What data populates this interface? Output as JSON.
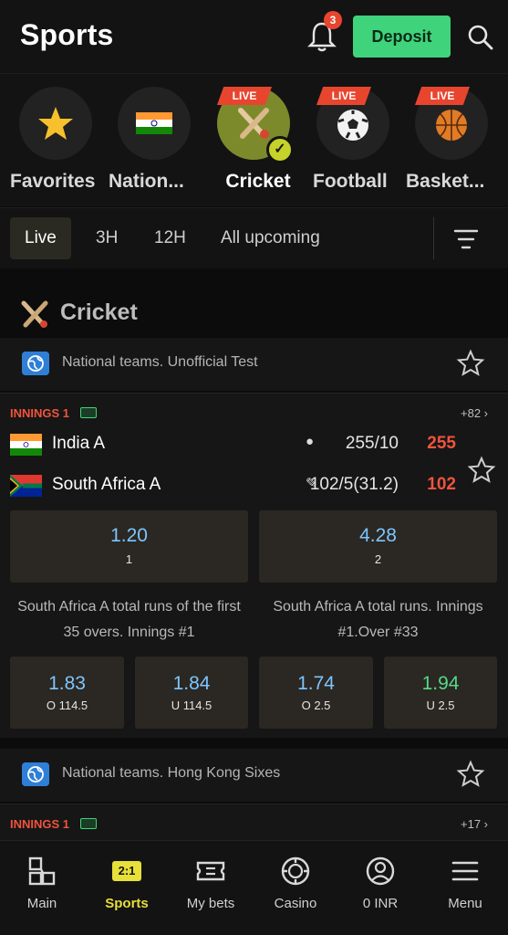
{
  "header": {
    "title": "Sports",
    "notifications_count": "3",
    "deposit_label": "Deposit"
  },
  "sports": [
    {
      "label": "Favorites",
      "icon": "star-icon",
      "live": false,
      "active": false
    },
    {
      "label": "Nation...",
      "icon": "india-flag-icon",
      "live": false,
      "active": false
    },
    {
      "label": "Cricket",
      "icon": "cricket-icon",
      "live": true,
      "active": true
    },
    {
      "label": "Football",
      "icon": "football-icon",
      "live": true,
      "active": false
    },
    {
      "label": "Basket...",
      "icon": "basketball-icon",
      "live": true,
      "active": false
    }
  ],
  "live_tag": "LIVE",
  "time_filters": [
    "Live",
    "3H",
    "12H",
    "All upcoming"
  ],
  "section": {
    "title": "Cricket"
  },
  "match1": {
    "league": "National teams. Unofficial Test",
    "innings": "INNINGS 1",
    "more": "+82 ›",
    "team1": {
      "name": "India A",
      "marker": "●",
      "score": "255/10",
      "total": "255"
    },
    "team2": {
      "name": "South Africa A",
      "marker": "✎",
      "score": "102/5(31.2)",
      "total": "102"
    },
    "main_odds": [
      {
        "value": "1.20",
        "label": "1"
      },
      {
        "value": "4.28",
        "label": "2"
      }
    ],
    "market1": {
      "title": "South Africa A total runs of the first 35 overs. Innings #1"
    },
    "market2": {
      "title": "South Africa A total runs. Innings #1.Over #33"
    },
    "market_odds": [
      {
        "value": "1.83",
        "label": "O 114.5"
      },
      {
        "value": "1.84",
        "label": "U 114.5"
      },
      {
        "value": "1.74",
        "label": "O 2.5"
      },
      {
        "value": "1.94",
        "label": "U 2.5"
      }
    ]
  },
  "match2": {
    "league": "National teams. Hong Kong Sixes",
    "innings": "INNINGS 1",
    "more": "+17 ›"
  },
  "nav": [
    {
      "label": "Main",
      "icon": "main-icon"
    },
    {
      "label": "Sports",
      "icon": "sports-ratio-icon",
      "badge": "2:1"
    },
    {
      "label": "My bets",
      "icon": "ticket-icon"
    },
    {
      "label": "Casino",
      "icon": "casino-chip-icon"
    },
    {
      "label": "0 INR",
      "icon": "user-icon"
    },
    {
      "label": "Menu",
      "icon": "menu-icon"
    }
  ],
  "colors": {
    "accent_green": "#3fd47b",
    "live_red": "#e8452f",
    "odds_blue": "#7cc6ff",
    "active_yellow": "#e7df3a"
  }
}
